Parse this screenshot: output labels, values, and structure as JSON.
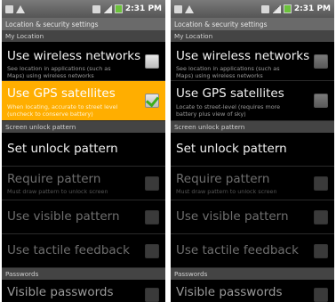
{
  "status_bar": {
    "time": "2:31 PM"
  },
  "screen_title": "Location & security settings",
  "sections": {
    "my_location": "My Location",
    "screen_unlock": "Screen unlock pattern",
    "passwords": "Passwords"
  },
  "left": {
    "wireless": {
      "title": "Use wireless networks",
      "summary": "See location in applications (such as Maps) using wireless networks",
      "checked": false
    },
    "gps": {
      "title": "Use GPS satellites",
      "summary": "When locating, accurate to street level (uncheck to conserve battery)",
      "checked": true,
      "highlighted": true
    }
  },
  "right": {
    "wireless": {
      "title": "Use wireless networks",
      "summary": "See location in applications (such as Maps) using wireless networks",
      "checked": false
    },
    "gps": {
      "title": "Use GPS satellites",
      "summary": "Locate to street-level (requires more battery plus view of sky)",
      "checked": false
    }
  },
  "unlock": {
    "set_pattern": "Set unlock pattern",
    "require_pattern": {
      "title": "Require pattern",
      "summary": "Must draw pattern to unlock screen"
    },
    "visible_pattern": "Use visible pattern",
    "tactile_feedback": "Use tactile feedback"
  },
  "passwords": {
    "visible_passwords": "Visible passwords"
  },
  "colors": {
    "highlight": "#ffae00",
    "check": "#3fae1c",
    "background": "#000000"
  }
}
